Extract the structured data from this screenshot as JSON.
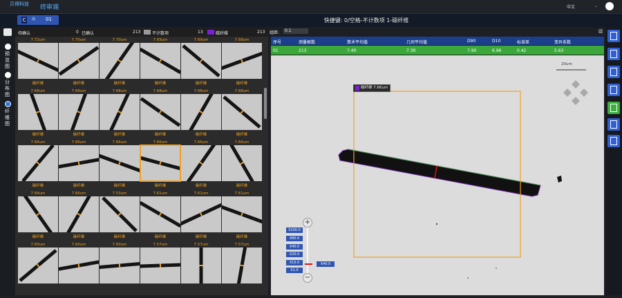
{
  "header": {
    "logo_text": "贝得科技",
    "app_name": "终审端",
    "language": "中文"
  },
  "mode": {
    "label": "C",
    "number": "01"
  },
  "shortcut_text": "快捷键: 0/空格-不计数项 1-碳纤维",
  "nav": {
    "items": [
      {
        "label": "预览图"
      },
      {
        "label": "分布图"
      },
      {
        "label": "纤维图"
      }
    ]
  },
  "grid_header": {
    "pending_label": "待确认",
    "pending_count": "0",
    "confirmed_label": "已确认",
    "confirmed_count": "213",
    "notcount_label": "不计数项",
    "notcount_count": "13",
    "fiber_label": "碳纤维",
    "fiber_count": "213",
    "notcount_color": "#9a9a9a",
    "fiber_color": "#7a1fd6"
  },
  "grid": {
    "rows": [
      {
        "label": "碳纤维",
        "values": [
          "7.72um",
          "7.70um",
          "7.70um",
          "7.69um",
          "7.69um",
          "7.68um"
        ]
      },
      {
        "label": "碳纤维",
        "values": [
          "7.68um",
          "7.68um",
          "7.68um",
          "7.68um",
          "7.68um",
          "7.68um"
        ]
      },
      {
        "label": "碳纤维",
        "values": [
          "7.66um",
          "7.66um",
          "7.66um",
          "7.66um",
          "7.66um",
          "7.66um"
        ]
      },
      {
        "label": "碳纤维",
        "values": [
          "7.66um",
          "7.66um",
          "7.53um",
          "7.61um",
          "7.61um",
          "7.61um"
        ]
      },
      {
        "label": "碳纤维",
        "values": [
          "7.60um",
          "7.60um",
          "7.60um",
          "7.57um",
          "7.57um",
          "7.57um"
        ]
      }
    ],
    "selected": "r2c3"
  },
  "filter": {
    "label": "组距:",
    "value": "0.1"
  },
  "table": {
    "headers": [
      "序号",
      "测量根数",
      "算术平均值",
      "几何平均值",
      "D90",
      "D10",
      "标准差",
      "变异系数"
    ],
    "row": [
      "01",
      "213",
      "7.40",
      "7.39",
      "7.90",
      "6.96",
      "0.42",
      "5.63"
    ]
  },
  "viewer": {
    "scalebar": "20um",
    "tag_label": "碳纤维 7.66um",
    "tag_color": "#7a1fd6",
    "zoom_levels": [
      "X200.0",
      "X80.0",
      "X40.0",
      "X20.0",
      "X10.0",
      "X1.0"
    ],
    "zoom_current": "X40.0",
    "zoom_in": "+",
    "zoom_out": "−"
  },
  "toolbar": {
    "icons": [
      "columns-icon",
      "report-icon",
      "print-icon",
      "export-icon",
      "ruler-icon",
      "settings-icon",
      "snapshot-icon"
    ]
  }
}
